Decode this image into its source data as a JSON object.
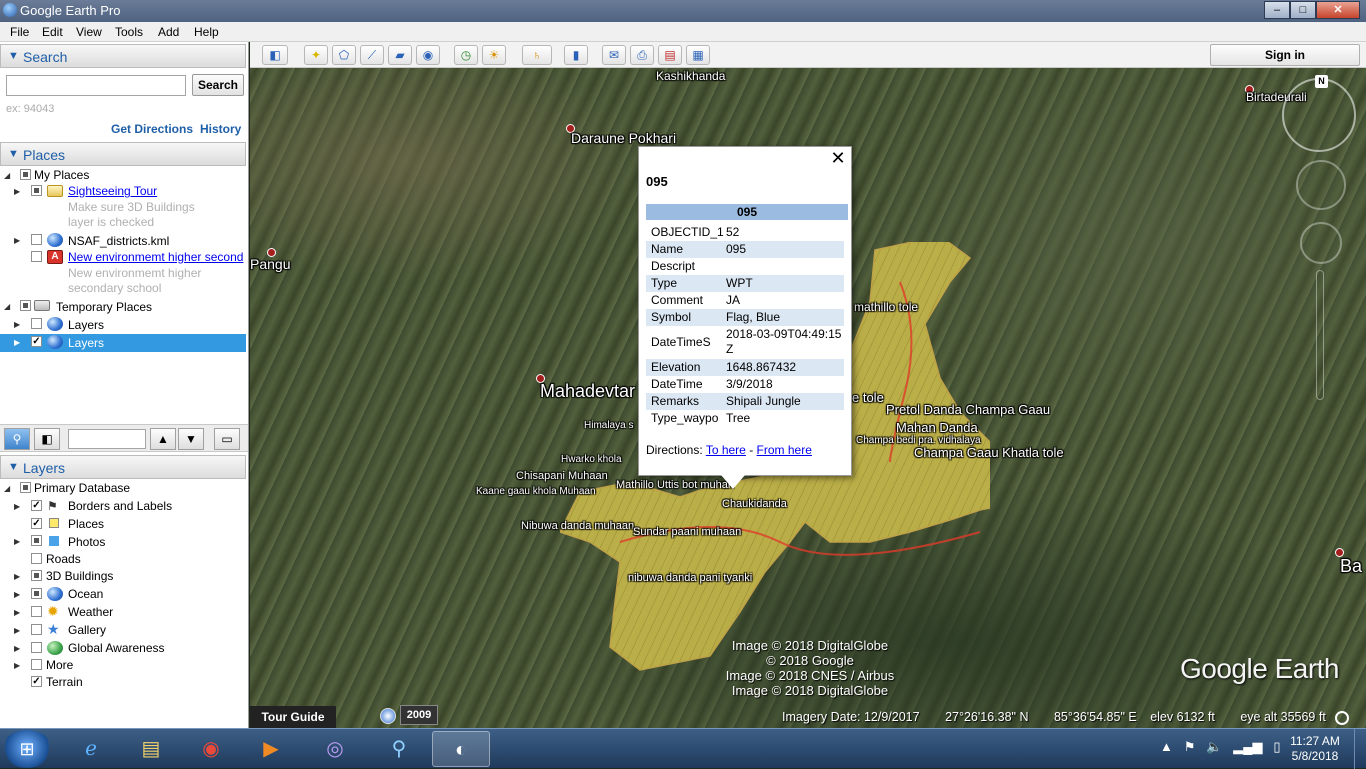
{
  "window": {
    "title": "Google Earth Pro",
    "minimize": "–",
    "maximize": "□",
    "close": "✕"
  },
  "menu": [
    "File",
    "Edit",
    "View",
    "Tools",
    "Add",
    "Help"
  ],
  "search_panel": {
    "header": "Search",
    "placeholder": "",
    "button": "Search",
    "hint": "ex: 94043",
    "get_directions": "Get Directions",
    "history": "History"
  },
  "places_panel": {
    "header": "Places",
    "my_places": "My Places",
    "sightseeing": "Sightseeing Tour",
    "sightseeing_desc1": "Make sure 3D Buildings",
    "sightseeing_desc2": "layer is checked",
    "nsaf": "NSAF_districts.kml",
    "school": "New environmemt higher second",
    "school_desc1": "New environmemt higher",
    "school_desc2": "secondary school",
    "temporary": "Temporary Places",
    "layers1": "Layers",
    "layers2": "Layers"
  },
  "layers_panel": {
    "header": "Layers",
    "primary": "Primary Database",
    "items": [
      "Borders and Labels",
      "Places",
      "Photos",
      "Roads",
      "3D Buildings",
      "Ocean",
      "Weather",
      "Gallery",
      "Global Awareness",
      "More",
      "Terrain"
    ]
  },
  "toolbar": {
    "sign_in": "Sign in"
  },
  "map_labels": {
    "kashikhanda": "Kashikhanda",
    "daraune": "Daraune Pokhari",
    "pangu": "Pangu",
    "birtadeurali": "Birtadeurali",
    "mahadevtar": "Mahadevtar",
    "mathillo": "mathillo tole",
    "e_tole": "e tole",
    "pretol": "Pretol Danda Champa Gaau",
    "mahan": "Mahan Danda",
    "champa_bedi": "Champa bedi pra. vidhalaya",
    "champa_gaau": "Champa Gaau Khatla tole",
    "himalaya": "Himalaya s",
    "hwarko": "Hwarko khola",
    "chisapani": "Chisapani Muhaan",
    "mathillo_uttis": "Mathillo Uttis bot muhan",
    "kaane": "Kaane gaau khola Muhaan",
    "chaukidanda": "Chaukidanda",
    "nibuwa": "Nibuwa danda muhaan",
    "sundar": "Sundar paani muhaan",
    "nibuwa_pani": "nibuwa danda pani tyanki",
    "ba": "Ba"
  },
  "balloon": {
    "close": "✕",
    "title": "095",
    "table_header": "095",
    "rows": [
      {
        "k": "OBJECTID_1",
        "v": "52"
      },
      {
        "k": "Name",
        "v": "095"
      },
      {
        "k": "Descript",
        "v": ""
      },
      {
        "k": "Type",
        "v": "WPT"
      },
      {
        "k": "Comment",
        "v": "JA"
      },
      {
        "k": "Symbol",
        "v": "Flag, Blue"
      },
      {
        "k": "DateTimeS",
        "v": "2018-03-09T04:49:15Z"
      },
      {
        "k": "Elevation",
        "v": "1648.867432"
      },
      {
        "k": "DateTime",
        "v": "3/9/2018"
      },
      {
        "k": "Remarks",
        "v": "Shipali Jungle"
      },
      {
        "k": "Type_waypo",
        "v": "Tree"
      }
    ],
    "directions_label": "Directions:",
    "to_here": "To here",
    "separator": "-",
    "from_here": "From here"
  },
  "copyright": [
    "Image © 2018 DigitalGlobe",
    "© 2018 Google",
    "Image © 2018 CNES / Airbus",
    "Image © 2018 DigitalGlobe"
  ],
  "logo": "Google Earth",
  "compass_n": "N",
  "bottom": {
    "tour_guide": "Tour Guide",
    "year": "2009",
    "imagery_date": "Imagery Date: 12/9/2017",
    "lat": "27°26'16.38\" N",
    "lon": "85°36'54.85\" E",
    "elev": "elev  6132 ft",
    "eye_alt": "eye alt  35569 ft"
  },
  "taskbar": {
    "time": "11:27 AM",
    "date": "5/8/2018"
  }
}
